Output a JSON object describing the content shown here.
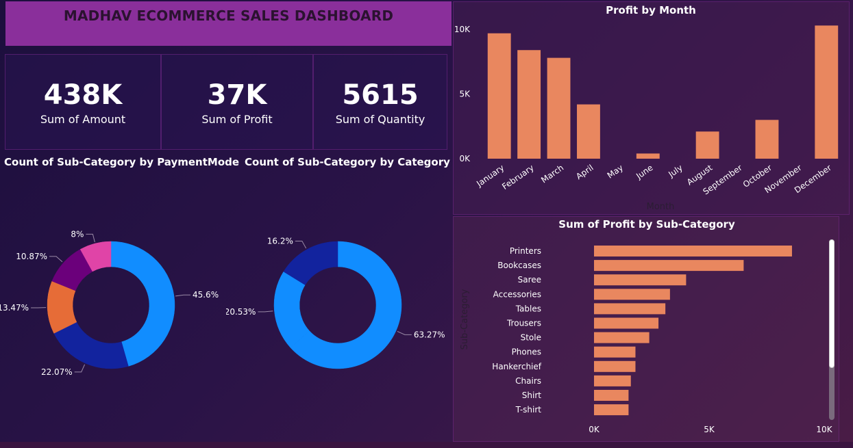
{
  "dashboard": {
    "title": "MADHAV ECOMMERCE SALES DASHBOARD"
  },
  "kpis": [
    {
      "value": "438K",
      "label": "Sum of Amount"
    },
    {
      "value": "37K",
      "label": "Sum of Profit"
    },
    {
      "value": "5615",
      "label": "Sum of Quantity"
    }
  ],
  "colors": {
    "bar": "#e9875f",
    "title_bar": "#8a2f9b",
    "donut_blue": "#118dff",
    "donut_navy": "#12239e",
    "donut_orange": "#e66c37",
    "donut_purple": "#6b007b",
    "donut_pink": "#e044a7"
  },
  "chart_data": [
    {
      "type": "pie",
      "title": "Count of Sub-Category by PaymentMode",
      "donut": true,
      "slices": [
        {
          "value": 45.6,
          "label": "45.6%",
          "color": "#118dff"
        },
        {
          "value": 22.07,
          "label": "22.07%",
          "color": "#12239e"
        },
        {
          "value": 13.47,
          "label": "13.47%",
          "color": "#e66c37"
        },
        {
          "value": 10.87,
          "label": "10.87%",
          "color": "#6b007b"
        },
        {
          "value": 8.0,
          "label": "8%",
          "color": "#e044a7"
        }
      ]
    },
    {
      "type": "pie",
      "title": "Count of Sub-Category by Category",
      "donut": true,
      "slices": [
        {
          "value": 63.27,
          "label": "63.27%",
          "color": "#118dff"
        },
        {
          "value": 20.53,
          "label": "20.53%",
          "color": "#118dff"
        },
        {
          "value": 16.2,
          "label": "16.2%",
          "color": "#12239e"
        }
      ]
    },
    {
      "type": "bar",
      "title": "Profit by Month",
      "xlabel": "Month",
      "ylabel": "",
      "categories": [
        "January",
        "February",
        "March",
        "April",
        "May",
        "June",
        "July",
        "August",
        "September",
        "October",
        "November",
        "December"
      ],
      "values": [
        9700,
        8400,
        7800,
        4200,
        0,
        400,
        0,
        2100,
        0,
        3000,
        0,
        10300
      ],
      "ylim": [
        0,
        10000
      ],
      "yticks": [
        "0K",
        "5K",
        "10K"
      ],
      "ytick_values": [
        0,
        5000,
        10000
      ],
      "orientation": "vertical"
    },
    {
      "type": "bar",
      "title": "Sum of Profit by Sub-Category",
      "xlabel": "",
      "ylabel": "Sub-Category",
      "categories": [
        "Printers",
        "Bookcases",
        "Saree",
        "Accessories",
        "Tables",
        "Trousers",
        "Stole",
        "Phones",
        "Hankerchief",
        "Chairs",
        "Shirt",
        "T-shirt"
      ],
      "values": [
        8600,
        6500,
        4000,
        3300,
        3100,
        2800,
        2400,
        1800,
        1800,
        1600,
        1500,
        1500
      ],
      "xlim": [
        0,
        10000
      ],
      "xticks": [
        "0K",
        "5K",
        "10K"
      ],
      "xtick_values": [
        0,
        5000,
        10000
      ],
      "orientation": "horizontal"
    }
  ]
}
